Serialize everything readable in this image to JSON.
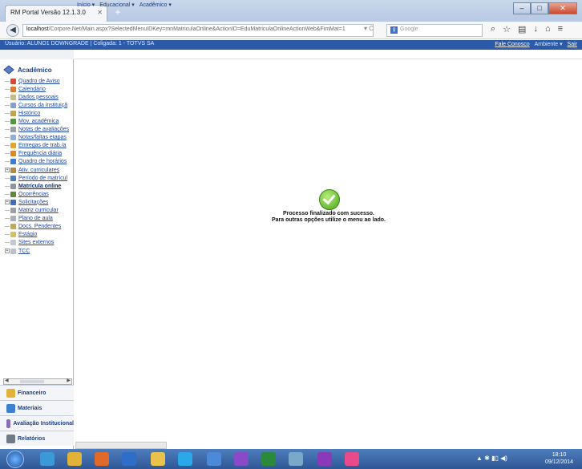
{
  "browser": {
    "tab_title": "RM Portal Versão 12.1.3.0",
    "url_host": "localhost",
    "url_rest": "/Corpore.Net/Main.aspx?SelectedMenuIDKey=mnMatriculaOnline&ActionID=EduMatriculaOnlineActionWeb&FimMat=1",
    "search_placeholder": "Google"
  },
  "userbar": {
    "left": "Usuário: ALUNO1 DOWNGRADE  |  Coligada: 1 - TOTVS SA",
    "fale": "Fale Conosco",
    "ambiente": "Ambiente ▾",
    "sair": "Sair"
  },
  "menus": [
    "Início ▾",
    "Educacional ▾",
    "Acadêmico ▾"
  ],
  "sidebar": {
    "title": "Acadêmico",
    "items": [
      {
        "label": "Quadro de Aviso",
        "plus": false,
        "color": "#d64a3a"
      },
      {
        "label": "Calendário",
        "plus": false,
        "color": "#e07a2e"
      },
      {
        "label": "Dados pessoais",
        "plus": false,
        "color": "#c9b98a"
      },
      {
        "label": "Cursos da instituiçã",
        "plus": false,
        "color": "#8aa0c8"
      },
      {
        "label": "Histórico",
        "plus": false,
        "color": "#c8a24a"
      },
      {
        "label": "Mov. acadêmica",
        "plus": false,
        "color": "#4f9a3a"
      },
      {
        "label": "Notas de avaliações",
        "plus": false,
        "color": "#9aa0a8"
      },
      {
        "label": "Notas/faltas etapas",
        "plus": false,
        "color": "#8fb0d8"
      },
      {
        "label": "Entregas de trab./a",
        "plus": false,
        "color": "#e2a62c"
      },
      {
        "label": "Frequência diária",
        "plus": false,
        "color": "#d8872a"
      },
      {
        "label": "Quadro de horários",
        "plus": false,
        "color": "#3a7bd5"
      },
      {
        "label": "Ativ. curriculares",
        "plus": true,
        "color": "#b38a3a"
      },
      {
        "label": "Período de matrícul",
        "plus": false,
        "color": "#4a7fc0"
      },
      {
        "label": "Matrícula online",
        "plus": false,
        "color": "#8c96a3",
        "bold": true
      },
      {
        "label": "Ocorrências",
        "plus": false,
        "color": "#5a8a3a"
      },
      {
        "label": "Solicitações",
        "plus": true,
        "color": "#3f6fb8"
      },
      {
        "label": "Matriz curricular",
        "plus": false,
        "color": "#9aa0a8"
      },
      {
        "label": "Plano de aula",
        "plus": false,
        "color": "#a8b0b8"
      },
      {
        "label": "Docs. Pendentes",
        "plus": false,
        "color": "#c8a84a"
      },
      {
        "label": "Estágio",
        "plus": false,
        "color": "#d8c05a"
      },
      {
        "label": "Sites externos",
        "plus": false,
        "color": "#c0c8d0"
      },
      {
        "label": "TCC",
        "plus": true,
        "color": "#b8c0c8"
      }
    ],
    "sections": [
      {
        "label": "Financeiro",
        "color": "#e2b33c"
      },
      {
        "label": "Materiais",
        "color": "#3f7fd0"
      },
      {
        "label": "Avaliação Institucional",
        "color": "#8a6fb8"
      },
      {
        "label": "Relatórios",
        "color": "#707a88"
      }
    ]
  },
  "main": {
    "line1": "Processo finalizado com sucesso.",
    "line2": "Para outras opções utilize o menu ao lado."
  },
  "taskbar": {
    "time": "18:10",
    "date": "09/12/2014",
    "icons": [
      {
        "name": "ie-icon",
        "color": "#3a9ad8"
      },
      {
        "name": "chrome-icon",
        "color": "#e0b23a"
      },
      {
        "name": "firefox-icon",
        "color": "#e06a2a"
      },
      {
        "name": "outlook-icon",
        "color": "#2f6ec8"
      },
      {
        "name": "folder-icon",
        "color": "#e8c24a"
      },
      {
        "name": "skype-icon",
        "color": "#2aa8e8"
      },
      {
        "name": "app-icon",
        "color": "#4a8ad8"
      },
      {
        "name": "visual-studio-icon",
        "color": "#8a4ac8"
      },
      {
        "name": "excel-icon",
        "color": "#2a8a3a"
      },
      {
        "name": "tool-icon",
        "color": "#7aa8c8"
      },
      {
        "name": "onenote-icon",
        "color": "#8a3ab8"
      },
      {
        "name": "colorful-app-icon",
        "color": "#e84a8a"
      }
    ]
  }
}
